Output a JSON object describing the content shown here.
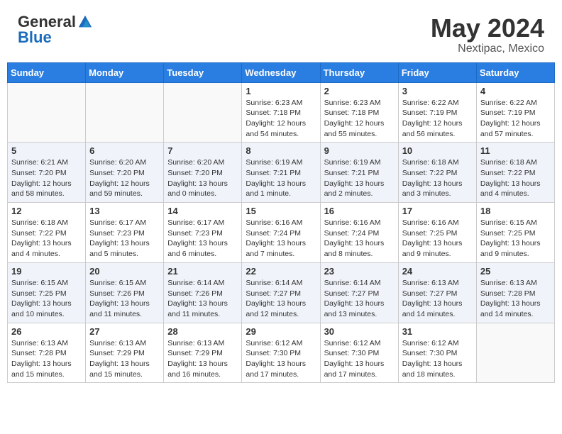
{
  "header": {
    "logo_general": "General",
    "logo_blue": "Blue",
    "month_year": "May 2024",
    "location": "Nextipac, Mexico"
  },
  "weekdays": [
    "Sunday",
    "Monday",
    "Tuesday",
    "Wednesday",
    "Thursday",
    "Friday",
    "Saturday"
  ],
  "weeks": [
    [
      {
        "day": "",
        "info": ""
      },
      {
        "day": "",
        "info": ""
      },
      {
        "day": "",
        "info": ""
      },
      {
        "day": "1",
        "info": "Sunrise: 6:23 AM\nSunset: 7:18 PM\nDaylight: 12 hours\nand 54 minutes."
      },
      {
        "day": "2",
        "info": "Sunrise: 6:23 AM\nSunset: 7:18 PM\nDaylight: 12 hours\nand 55 minutes."
      },
      {
        "day": "3",
        "info": "Sunrise: 6:22 AM\nSunset: 7:19 PM\nDaylight: 12 hours\nand 56 minutes."
      },
      {
        "day": "4",
        "info": "Sunrise: 6:22 AM\nSunset: 7:19 PM\nDaylight: 12 hours\nand 57 minutes."
      }
    ],
    [
      {
        "day": "5",
        "info": "Sunrise: 6:21 AM\nSunset: 7:20 PM\nDaylight: 12 hours\nand 58 minutes."
      },
      {
        "day": "6",
        "info": "Sunrise: 6:20 AM\nSunset: 7:20 PM\nDaylight: 12 hours\nand 59 minutes."
      },
      {
        "day": "7",
        "info": "Sunrise: 6:20 AM\nSunset: 7:20 PM\nDaylight: 13 hours\nand 0 minutes."
      },
      {
        "day": "8",
        "info": "Sunrise: 6:19 AM\nSunset: 7:21 PM\nDaylight: 13 hours\nand 1 minute."
      },
      {
        "day": "9",
        "info": "Sunrise: 6:19 AM\nSunset: 7:21 PM\nDaylight: 13 hours\nand 2 minutes."
      },
      {
        "day": "10",
        "info": "Sunrise: 6:18 AM\nSunset: 7:22 PM\nDaylight: 13 hours\nand 3 minutes."
      },
      {
        "day": "11",
        "info": "Sunrise: 6:18 AM\nSunset: 7:22 PM\nDaylight: 13 hours\nand 4 minutes."
      }
    ],
    [
      {
        "day": "12",
        "info": "Sunrise: 6:18 AM\nSunset: 7:22 PM\nDaylight: 13 hours\nand 4 minutes."
      },
      {
        "day": "13",
        "info": "Sunrise: 6:17 AM\nSunset: 7:23 PM\nDaylight: 13 hours\nand 5 minutes."
      },
      {
        "day": "14",
        "info": "Sunrise: 6:17 AM\nSunset: 7:23 PM\nDaylight: 13 hours\nand 6 minutes."
      },
      {
        "day": "15",
        "info": "Sunrise: 6:16 AM\nSunset: 7:24 PM\nDaylight: 13 hours\nand 7 minutes."
      },
      {
        "day": "16",
        "info": "Sunrise: 6:16 AM\nSunset: 7:24 PM\nDaylight: 13 hours\nand 8 minutes."
      },
      {
        "day": "17",
        "info": "Sunrise: 6:16 AM\nSunset: 7:25 PM\nDaylight: 13 hours\nand 9 minutes."
      },
      {
        "day": "18",
        "info": "Sunrise: 6:15 AM\nSunset: 7:25 PM\nDaylight: 13 hours\nand 9 minutes."
      }
    ],
    [
      {
        "day": "19",
        "info": "Sunrise: 6:15 AM\nSunset: 7:25 PM\nDaylight: 13 hours\nand 10 minutes."
      },
      {
        "day": "20",
        "info": "Sunrise: 6:15 AM\nSunset: 7:26 PM\nDaylight: 13 hours\nand 11 minutes."
      },
      {
        "day": "21",
        "info": "Sunrise: 6:14 AM\nSunset: 7:26 PM\nDaylight: 13 hours\nand 11 minutes."
      },
      {
        "day": "22",
        "info": "Sunrise: 6:14 AM\nSunset: 7:27 PM\nDaylight: 13 hours\nand 12 minutes."
      },
      {
        "day": "23",
        "info": "Sunrise: 6:14 AM\nSunset: 7:27 PM\nDaylight: 13 hours\nand 13 minutes."
      },
      {
        "day": "24",
        "info": "Sunrise: 6:13 AM\nSunset: 7:27 PM\nDaylight: 13 hours\nand 14 minutes."
      },
      {
        "day": "25",
        "info": "Sunrise: 6:13 AM\nSunset: 7:28 PM\nDaylight: 13 hours\nand 14 minutes."
      }
    ],
    [
      {
        "day": "26",
        "info": "Sunrise: 6:13 AM\nSunset: 7:28 PM\nDaylight: 13 hours\nand 15 minutes."
      },
      {
        "day": "27",
        "info": "Sunrise: 6:13 AM\nSunset: 7:29 PM\nDaylight: 13 hours\nand 15 minutes."
      },
      {
        "day": "28",
        "info": "Sunrise: 6:13 AM\nSunset: 7:29 PM\nDaylight: 13 hours\nand 16 minutes."
      },
      {
        "day": "29",
        "info": "Sunrise: 6:12 AM\nSunset: 7:30 PM\nDaylight: 13 hours\nand 17 minutes."
      },
      {
        "day": "30",
        "info": "Sunrise: 6:12 AM\nSunset: 7:30 PM\nDaylight: 13 hours\nand 17 minutes."
      },
      {
        "day": "31",
        "info": "Sunrise: 6:12 AM\nSunset: 7:30 PM\nDaylight: 13 hours\nand 18 minutes."
      },
      {
        "day": "",
        "info": ""
      }
    ]
  ]
}
